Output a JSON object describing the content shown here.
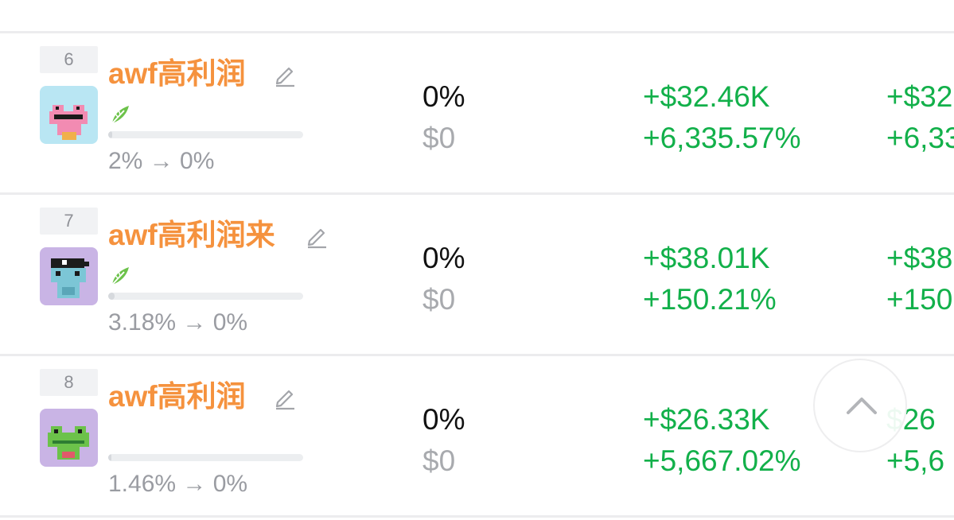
{
  "rows": [
    {
      "rank": "6",
      "name": "awf高利润",
      "name_width": 192,
      "avatar_icon": "pink-frog-avatar-icon",
      "avatar_bg": "#b9e6f3",
      "share_change": "2% → 0%",
      "share_fill": 0.02,
      "weight_pct": "0%",
      "weight_usd": "$0",
      "pnl_usd": "+$32.46K",
      "pnl_pct": "+6,335.57%",
      "pnl2_usd": "+$32",
      "pnl2_pct": "+6,33",
      "has_leaf": true
    },
    {
      "rank": "7",
      "name": "awf高利润来",
      "name_width": 232,
      "avatar_icon": "pirate-frog-avatar-icon",
      "avatar_bg": "#c9b4e5",
      "share_change": "3.18% → 0%",
      "share_fill": 0.0318,
      "weight_pct": "0%",
      "weight_usd": "$0",
      "pnl_usd": "+$38.01K",
      "pnl_pct": "+150.21%",
      "pnl2_usd": "+$38",
      "pnl2_pct": "+150",
      "has_leaf": true
    },
    {
      "rank": "8",
      "name": "awf高利润",
      "name_width": 192,
      "avatar_icon": "green-frog-avatar-icon",
      "avatar_bg": "#c9b4e5",
      "share_change": "1.46% → 0%",
      "share_fill": 0.0146,
      "weight_pct": "0%",
      "weight_usd": "$0",
      "pnl_usd": "+$26.33K",
      "pnl_pct": "+5,667.02%",
      "pnl2_usd": "$26",
      "pnl2_pct": "+5,6",
      "has_leaf": false
    }
  ],
  "colors": {
    "name_orange": "#f5923e",
    "profit_green": "#12b04a",
    "muted_gray": "#a8aaae",
    "leaf_green": "#6cc24a"
  },
  "icons": {
    "edit": "pencil-edit-icon",
    "tag": "leaf-icon",
    "scroll_top": "chevron-up-icon"
  }
}
